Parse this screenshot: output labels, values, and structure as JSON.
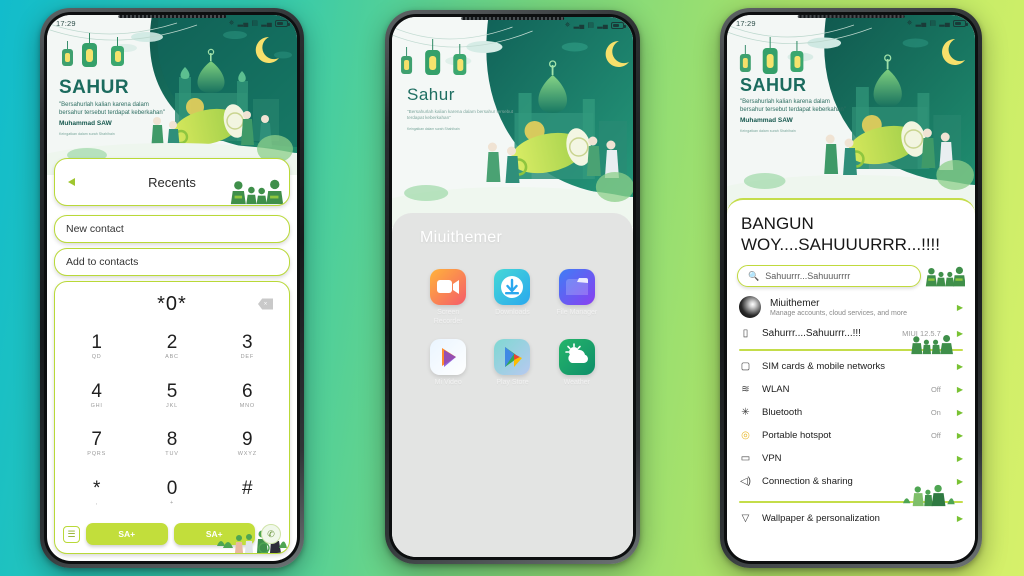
{
  "background": {
    "gradient_from": "#12bccc",
    "gradient_to": "#d6f06a"
  },
  "accent": {
    "lime": "#c2de3b",
    "lime_border": "#c0da3d",
    "green_arrow": "#79c233",
    "teal": "#12bccc"
  },
  "wallpaper": {
    "title_phone1": "SAHUR",
    "title_phone2": "Sahur",
    "title_phone3": "SAHUR",
    "quote": "\"Bersahurlah kalian karena dalam bersahur tersebut terdapat keberkahan\"",
    "author": "Muhammad SAW",
    "subnote": "Keingatkan dalam surah Shahihain"
  },
  "statusbar": {
    "time": "17:29",
    "icons": [
      "bluetooth-icon",
      "signal-icon",
      "sim-icon",
      "signal2-icon",
      "battery-icon"
    ]
  },
  "phone1": {
    "recents": {
      "label": "Recents",
      "back_icon": "back-triangle-icon"
    },
    "new_contact": "New contact",
    "add_to_contacts": "Add to contacts",
    "dialer": {
      "display": "*0*",
      "backspace_icon": "backspace-icon",
      "keys": [
        {
          "digit": "1",
          "letters": "QD"
        },
        {
          "digit": "2",
          "letters": "ABC"
        },
        {
          "digit": "3",
          "letters": "DEF"
        },
        {
          "digit": "4",
          "letters": "GHI"
        },
        {
          "digit": "5",
          "letters": "JKL"
        },
        {
          "digit": "6",
          "letters": "MNO"
        },
        {
          "digit": "7",
          "letters": "PQRS"
        },
        {
          "digit": "8",
          "letters": "TUV"
        },
        {
          "digit": "9",
          "letters": "WXYZ"
        },
        {
          "digit": "*",
          "letters": ","
        },
        {
          "digit": "0",
          "letters": "+"
        },
        {
          "digit": "#",
          "letters": ""
        }
      ]
    },
    "actionbar": {
      "list_icon": "list-icon",
      "call_button_1": "SA+",
      "call_button_2": "SA+",
      "round_icon": "call-icon"
    }
  },
  "phone2": {
    "drawer_title": "Miuithemer",
    "apps": [
      {
        "name": "Screen Recorder",
        "icon": "video-camera-icon",
        "c1": "#ffb33a",
        "c2": "#f55b6a"
      },
      {
        "name": "Downloads",
        "icon": "download-icon",
        "c1": "#45d8d6",
        "c2": "#2aa8ee"
      },
      {
        "name": "File Manager",
        "icon": "folder-icon",
        "c1": "#3f7ef5",
        "c2": "#8a3ff0"
      },
      {
        "name": "Mi Video",
        "icon": "play-icon",
        "c1": "#eaf5ff",
        "c2": "#ffffff"
      },
      {
        "name": "Play Store",
        "icon": "play-store-icon",
        "c1": "#7fd8d2",
        "c2": "#b7c9f0"
      },
      {
        "name": "Weather",
        "icon": "sun-cloud-icon",
        "c1": "#25b56a",
        "c2": "#0f8e6a"
      }
    ]
  },
  "phone3": {
    "title": "BANGUN WOY....SAHUUURRR...!!!!",
    "search_placeholder": "Sahuurrr...Sahuuurrrr",
    "search_icon": "search-icon",
    "account": {
      "name": "Miuithemer",
      "description": "Manage accounts, cloud services, and more",
      "avatar": "avatar"
    },
    "about_row": {
      "icon": "phone-icon",
      "label": "Sahurrr....Sahuurrr...!!!",
      "value": "MIUI 12.5.7"
    },
    "settings": [
      {
        "icon": "sim-card-icon",
        "label": "SIM cards & mobile networks",
        "value": ""
      },
      {
        "icon": "wifi-icon",
        "label": "WLAN",
        "value": "Off"
      },
      {
        "icon": "bluetooth-icon",
        "label": "Bluetooth",
        "value": "On"
      },
      {
        "icon": "hotspot-icon",
        "label": "Portable hotspot",
        "value": "Off"
      },
      {
        "icon": "vpn-icon",
        "label": "VPN",
        "value": ""
      },
      {
        "icon": "share-icon",
        "label": "Connection & sharing",
        "value": ""
      }
    ],
    "settings2": [
      {
        "icon": "wallpaper-icon",
        "label": "Wallpaper & personalization",
        "value": ""
      }
    ]
  }
}
